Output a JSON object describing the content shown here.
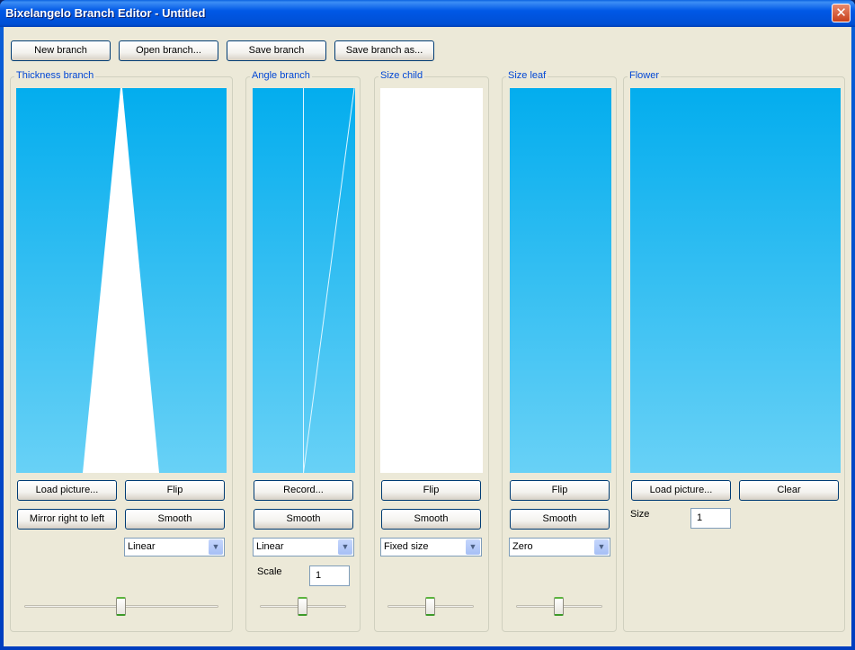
{
  "window": {
    "title": "Bixelangelo Branch Editor - Untitled",
    "close_icon": "close-icon"
  },
  "toolbar": {
    "new": "New branch",
    "open": "Open branch...",
    "save": "Save branch",
    "save_as": "Save branch as..."
  },
  "thickness": {
    "label": "Thickness branch",
    "load": "Load picture...",
    "flip": "Flip",
    "mirror": "Mirror right to left",
    "smooth": "Smooth",
    "mode": "Linear",
    "slider_value": 0.5
  },
  "angle": {
    "label": "Angle branch",
    "record": "Record...",
    "smooth": "Smooth",
    "mode": "Linear",
    "scale_label": "Scale",
    "scale_value": "1",
    "slider_value": 0.5
  },
  "size_child": {
    "label": "Size child",
    "flip": "Flip",
    "smooth": "Smooth",
    "mode": "Fixed size",
    "slider_value": 0.5
  },
  "size_leaf": {
    "label": "Size leaf",
    "flip": "Flip",
    "smooth": "Smooth",
    "mode": "Zero",
    "slider_value": 0.5
  },
  "flower": {
    "label": "Flower",
    "load": "Load picture...",
    "clear": "Clear",
    "size_label": "Size",
    "size_value": "1"
  }
}
